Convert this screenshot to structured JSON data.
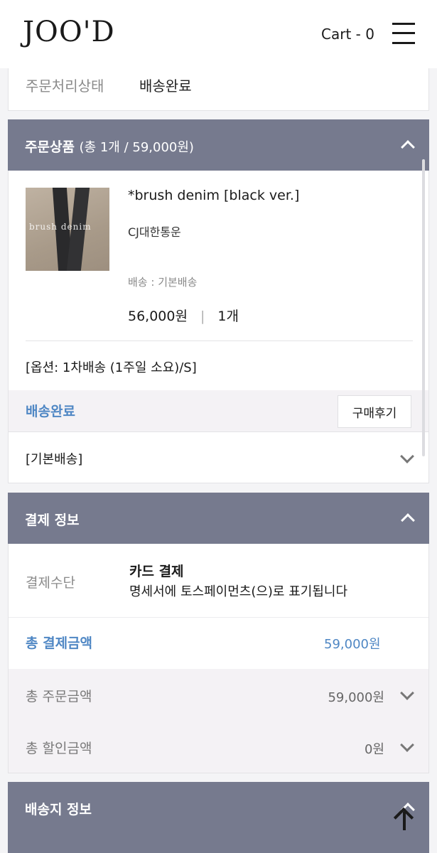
{
  "header": {
    "logo": "JOO'D",
    "cart_label": "Cart - 0"
  },
  "order_status": {
    "label": "주문처리상태",
    "value": "배송완료"
  },
  "order_items": {
    "title": "주문상품",
    "summary": "(총 1개 / 59,000원)",
    "product": {
      "name": "*brush denim [black ver.]",
      "courier": "CJ대한통운",
      "shipping": "배송 : 기본배송",
      "price": "56,000원",
      "quantity": "1개",
      "thumb_text": "brush denim",
      "option": "[옵션: 1차배송 (1주일 소요)/S]",
      "status": "배송완료",
      "review_button": "구매후기"
    },
    "shipping_group": "[기본배송]"
  },
  "payment": {
    "title": "결제 정보",
    "method_label": "결제수단",
    "method": "카드 결제",
    "method_note": "명세서에 토스페이먼츠(으)로 표기됩니다",
    "total_label": "총 결제금액",
    "total_value": "59,000원",
    "order_total_label": "총 주문금액",
    "order_total_value": "59,000원",
    "discount_label": "총 할인금액",
    "discount_value": "0원"
  },
  "delivery": {
    "title": "배송지 정보"
  },
  "icons": {
    "menu": "hamburger-menu-icon",
    "collapse": "chevron-up-icon",
    "expand": "chevron-down-icon",
    "scroll_top": "arrow-up-icon"
  },
  "colors": {
    "section_header": "#767a8e",
    "accent_blue": "#4f87c4"
  }
}
